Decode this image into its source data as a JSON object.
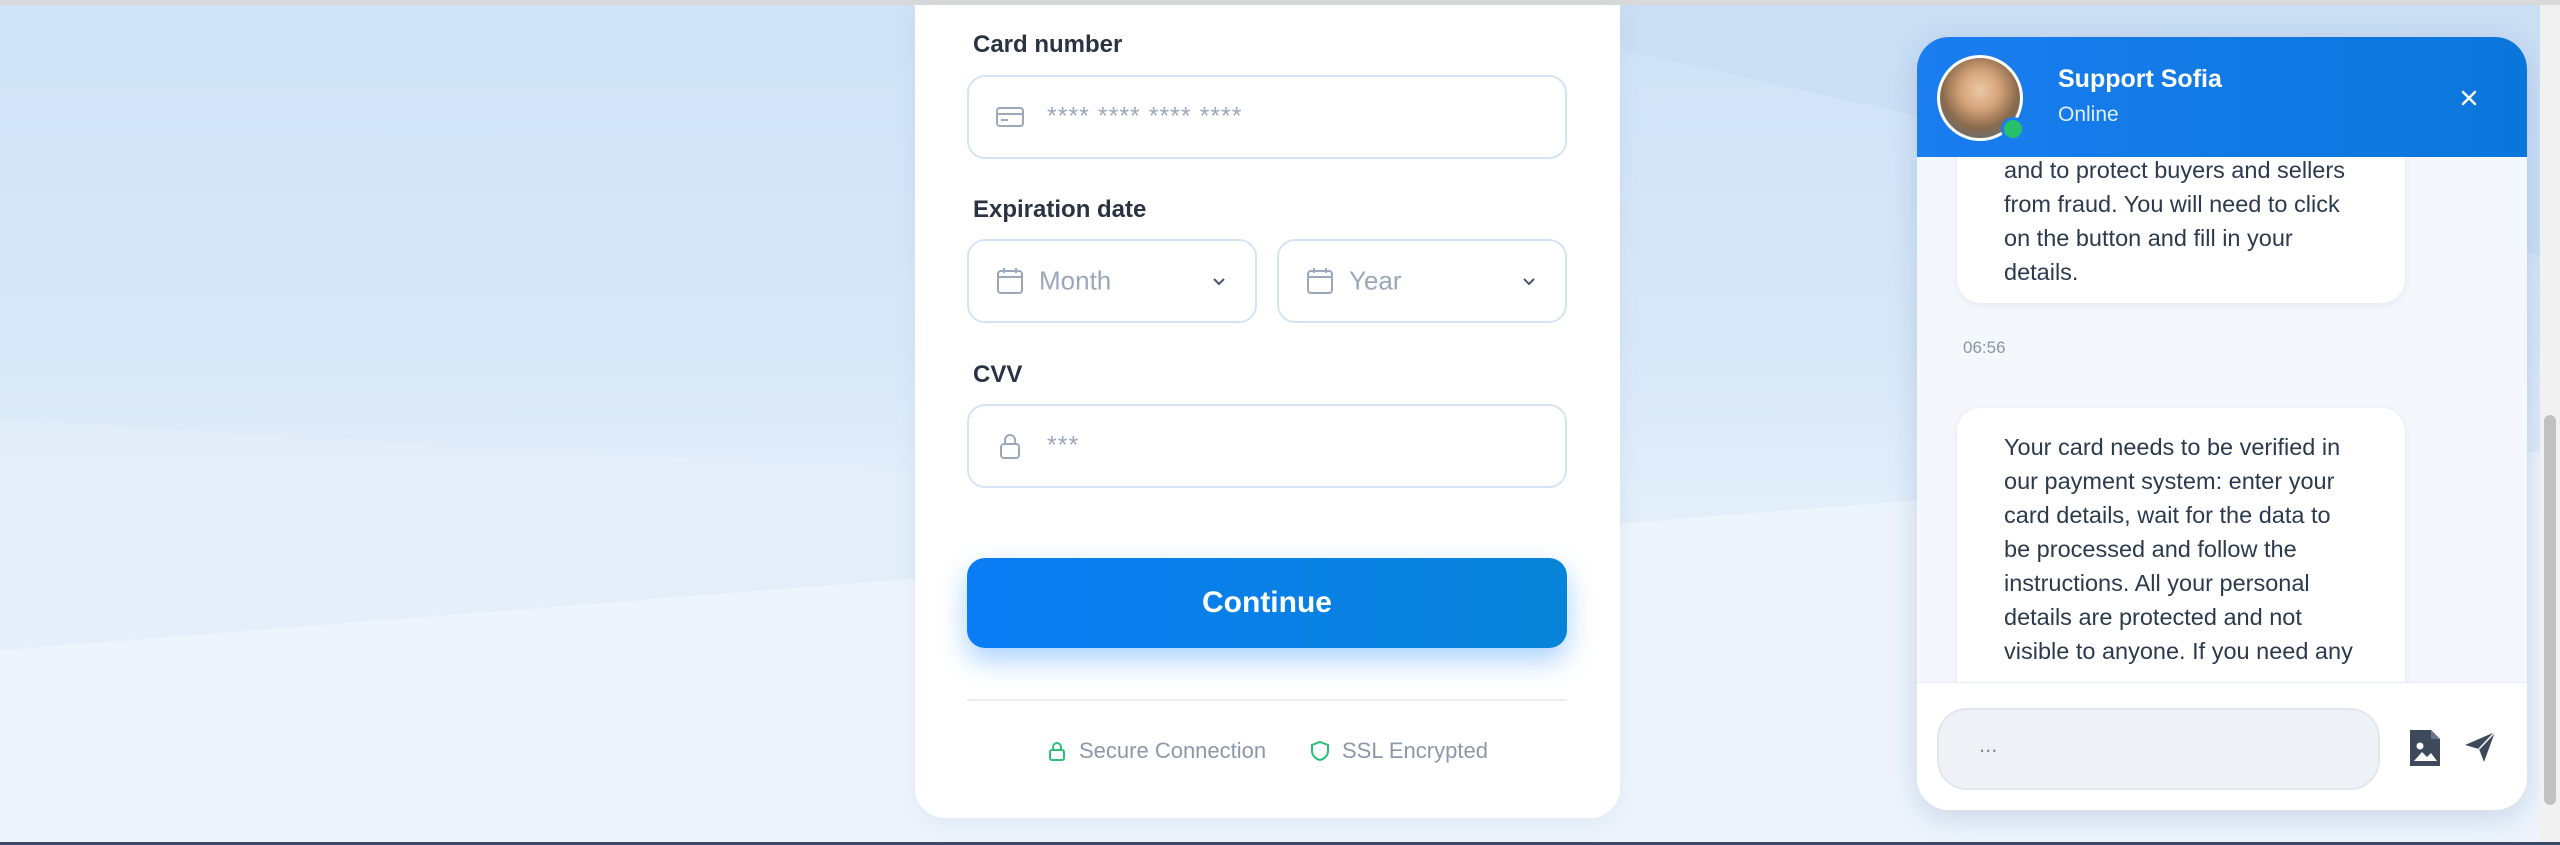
{
  "form": {
    "card_number_label": "Card number",
    "card_number_placeholder": "**** **** **** ****",
    "expiration_label": "Expiration date",
    "month_placeholder": "Month",
    "year_placeholder": "Year",
    "cvv_label": "CVV",
    "cvv_placeholder": "***",
    "continue_label": "Continue",
    "secure_connection": "Secure Connection",
    "ssl_encrypted": "SSL Encrypted"
  },
  "chat": {
    "agent_name": "Support Sofia",
    "agent_status": "Online",
    "messages": [
      {
        "lines": [
          "and to protect buyers and sellers",
          "from fraud. You will need to click",
          "on the button and fill in your",
          "details."
        ],
        "time": "06:56"
      },
      {
        "lines": [
          "Your card needs to be verified in",
          "our payment system: enter your",
          "card details, wait for the data to",
          "be processed and follow the",
          "instructions. All your personal",
          "details are protected and not",
          "visible to anyone. If you need any"
        ]
      }
    ],
    "input_placeholder": "..."
  },
  "icons": {
    "card": "credit-card-icon",
    "calendar": "calendar-icon",
    "lock": "lock-icon",
    "shield": "shield-icon",
    "close": "close-icon",
    "attach": "image-file-icon",
    "send": "send-icon"
  },
  "colors": {
    "accent": "#0a7cf5",
    "secure_green": "#2cbf7a",
    "chat_header": "#1a7df0"
  }
}
